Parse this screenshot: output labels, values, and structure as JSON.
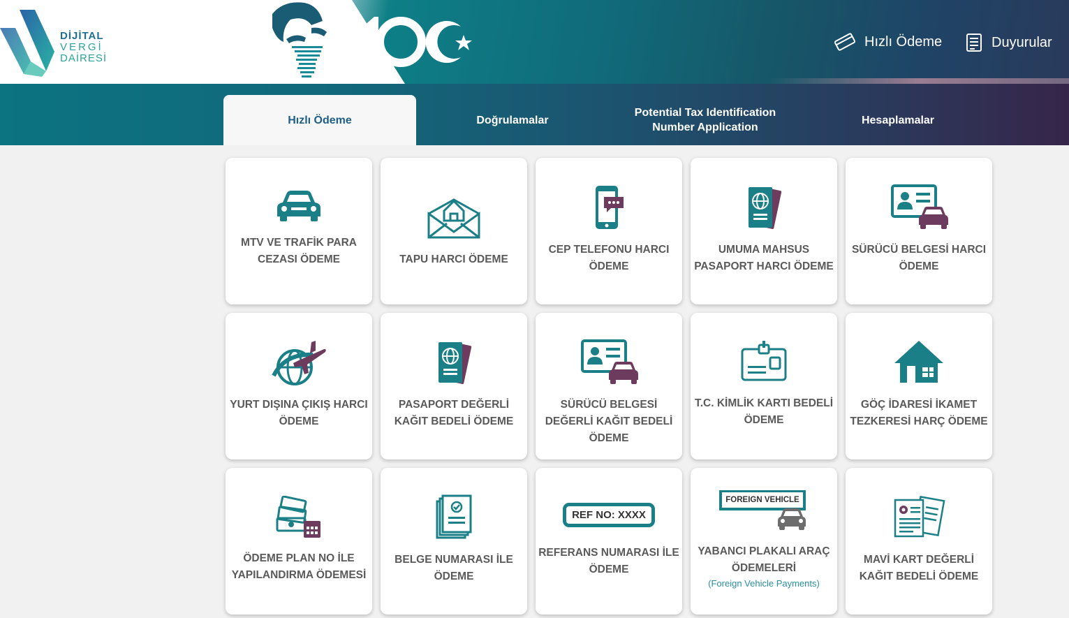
{
  "brand": {
    "line1": "DİJİTAL",
    "line2": "VERGİ",
    "line3": "DAİRESİ",
    "centennial": "100"
  },
  "header_links": [
    {
      "label": "Hızlı Ödeme",
      "icon": "card-icon"
    },
    {
      "label": "Duyurular",
      "icon": "document-icon"
    }
  ],
  "tabs": [
    {
      "label": "Hızlı Ödeme",
      "active": true
    },
    {
      "label": "Doğrulamalar",
      "active": false
    },
    {
      "label": "Potential Tax Identification Number Application",
      "active": false
    },
    {
      "label": "Hesaplamalar",
      "active": false
    }
  ],
  "cards": [
    {
      "label": "MTV VE TRAFİK PARA CEZASI ÖDEME",
      "icon": "car-icon"
    },
    {
      "label": "TAPU HARCI ÖDEME",
      "icon": "house-envelope-icon"
    },
    {
      "label": "CEP TELEFONU HARCI ÖDEME",
      "icon": "mobile-phone-icon"
    },
    {
      "label": "UMUMA MAHSUS PASAPORT HARCI ÖDEME",
      "icon": "passport-icon"
    },
    {
      "label": "SÜRÜCÜ BELGESİ HARCI ÖDEME",
      "icon": "driver-license-icon"
    },
    {
      "label": "YURT DIŞINA ÇIKIŞ HARCI ÖDEME",
      "icon": "globe-plane-icon"
    },
    {
      "label": "PASAPORT DEĞERLİ KAĞIT BEDELİ ÖDEME",
      "icon": "passport-icon"
    },
    {
      "label": "SÜRÜCÜ BELGESİ DEĞERLİ KAĞIT BEDELİ ÖDEME",
      "icon": "driver-license-icon"
    },
    {
      "label": "T.C. KİMLİK KARTI BEDELİ ÖDEME",
      "icon": "id-card-icon"
    },
    {
      "label": "GÖÇ İDARESİ İKAMET TEZKERESİ HARÇ ÖDEME",
      "icon": "home-icon"
    },
    {
      "label": "ÖDEME PLAN NO İLE YAPILANDIRMA ÖDEMESİ",
      "icon": "money-calendar-icon"
    },
    {
      "label": "BELGE NUMARASI İLE ÖDEME",
      "icon": "document-check-icon"
    },
    {
      "label": "REFERANS NUMARASI İLE ÖDEME",
      "icon": "ref-number-icon",
      "badge": "REF NO: XXXX"
    },
    {
      "label": "YABANCI PLAKALI ARAÇ ÖDEMELERİ",
      "icon": "foreign-vehicle-icon",
      "badge": "FOREIGN VEHICLE",
      "sub": "(Foreign Vehicle Payments)"
    },
    {
      "label": "MAVİ KART DEĞERLİ KAĞIT BEDELİ ÖDEME",
      "icon": "blue-card-docs-icon"
    }
  ],
  "colors": {
    "teal": "#1b7f87",
    "purple": "#6c3b5e",
    "tab_active_text": "#1f5f86",
    "label": "#5a5a5a",
    "sub": "#2a8fa0"
  }
}
